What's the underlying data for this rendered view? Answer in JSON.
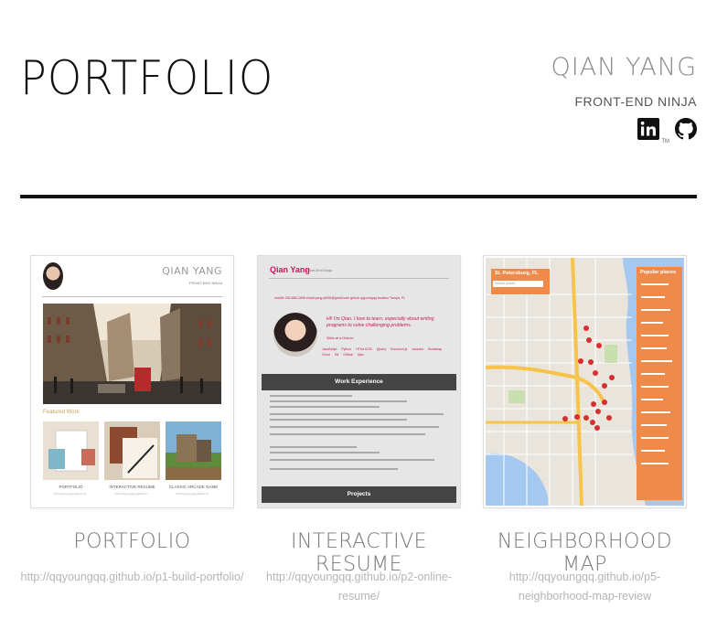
{
  "header": {
    "title": "PORTFOLIO",
    "owner_name": "QIAN YANG",
    "owner_role": "FRONT-END NINJA",
    "social": [
      {
        "icon": "linkedin-icon",
        "label": "in",
        "trademark": "TM"
      },
      {
        "icon": "github-icon"
      }
    ]
  },
  "projects": [
    {
      "title": "PORTFOLIO",
      "url": "http://qqyoungqq.github.io/p1-build-portfolio/",
      "thumbnail": {
        "name": "QIAN YANG",
        "role": "FRONT-END NINJA",
        "featured_label": "Featured Work",
        "items": [
          {
            "caption": "PORTFOLIO",
            "sub": "http://qqyoungqq.github.io/..."
          },
          {
            "caption": "INTERACTIVE RESUME",
            "sub": "http://qqyoungqq.github.io/..."
          },
          {
            "caption": "CLASSIC ARCADE GAME",
            "sub": "http://qqyoungqq.github.io/..."
          }
        ]
      }
    },
    {
      "title": "INTERACTIVE RESUME",
      "url": "http://qqyoungqq.github.io/p2-online-resume/",
      "thumbnail": {
        "name": "Qian Yang",
        "role": "Front-End Ninja",
        "contact": "mobile 330-883-1656   email yang.qi936@gmail.com   github qqyoungqq   location Tampa, FL",
        "quote": "Hi! I'm Qian. I love to learn, especially about writing programs to solve challenging problems.",
        "hire": "Skills at a Glance:",
        "skills": "JavaScript Python HTML/CSS jQuery Knockout.js Javadoc Bootstrap Grunt Git GitHub Ajax",
        "section_work": "Work Experience",
        "section_projects": "Projects"
      }
    },
    {
      "title": "NEIGHBORHOOD MAP",
      "url": "http://qqyoungqq.github.io/p5-neighborhood-map-review",
      "thumbnail": {
        "city": "St. Petersburg, FL",
        "panel_title": "Popular places",
        "search_placeholder": "Search places"
      }
    }
  ],
  "colors": {
    "divider": "#111111",
    "muted_text": "#777777",
    "url_text": "#b5b5b5",
    "resume_accent": "#c2185b",
    "map_panel": "#f08a4b"
  }
}
